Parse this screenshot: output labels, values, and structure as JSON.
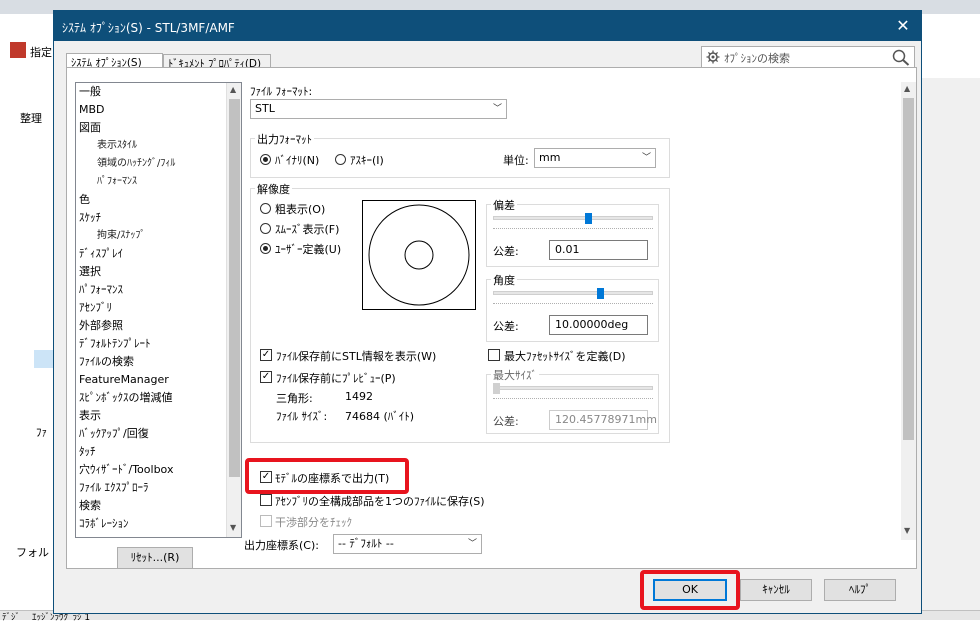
{
  "dialog": {
    "title": "ｼｽﾃﾑ ｵﾌﾟｼｮﾝ(S) - STL/3MF/AMF",
    "close": "✕",
    "tabs": [
      "ｼｽﾃﾑ ｵﾌﾟｼｮﾝ(S)",
      "ﾄﾞｷｭﾒﾝﾄ ﾌﾟﾛﾊﾟﾃｨ(D)"
    ],
    "search_placeholder": "ｵﾌﾟｼｮﾝの検索"
  },
  "tree": {
    "items": [
      {
        "label": "一般",
        "sub": false
      },
      {
        "label": "MBD",
        "sub": false
      },
      {
        "label": "図面",
        "sub": false
      },
      {
        "label": "表示ｽﾀｲﾙ",
        "sub": true
      },
      {
        "label": "領域のﾊｯﾁﾝｸﾞ/ﾌｨﾙ",
        "sub": true
      },
      {
        "label": "ﾊﾟﾌｫｰﾏﾝｽ",
        "sub": true
      },
      {
        "label": "色",
        "sub": false
      },
      {
        "label": "ｽｹｯﾁ",
        "sub": false
      },
      {
        "label": "拘束/ｽﾅｯﾌﾟ",
        "sub": true
      },
      {
        "label": "ﾃﾞｨｽﾌﾟﾚｲ",
        "sub": false
      },
      {
        "label": "選択",
        "sub": false
      },
      {
        "label": "ﾊﾟﾌｫｰﾏﾝｽ",
        "sub": false
      },
      {
        "label": "ｱｾﾝﾌﾞﾘ",
        "sub": false
      },
      {
        "label": "外部参照",
        "sub": false
      },
      {
        "label": "ﾃﾞﾌｫﾙﾄﾃﾝﾌﾟﾚｰﾄ",
        "sub": false
      },
      {
        "label": "ﾌｧｲﾙの検索",
        "sub": false
      },
      {
        "label": "FeatureManager",
        "sub": false
      },
      {
        "label": "ｽﾋﾟﾝﾎﾞｯｸｽの増減値",
        "sub": false
      },
      {
        "label": "表示",
        "sub": false
      },
      {
        "label": "ﾊﾞｯｸｱｯﾌﾟ/回復",
        "sub": false
      },
      {
        "label": "ﾀｯﾁ",
        "sub": false
      },
      {
        "label": "穴ｳｨｻﾞｰﾄﾞ/Toolbox",
        "sub": false
      },
      {
        "label": "ﾌｧｲﾙ ｴｸｽﾌﾟﾛｰﾗ",
        "sub": false
      },
      {
        "label": "検索",
        "sub": false
      },
      {
        "label": "ｺﾗﾎﾞﾚｰｼｮﾝ",
        "sub": false
      }
    ],
    "reset_button": "ﾘｾｯﾄ...(R)"
  },
  "file_format": {
    "label": "ﾌｧｲﾙ ﾌｫｰﾏｯﾄ:",
    "value": "STL"
  },
  "output_format": {
    "legend": "出力ﾌｫｰﾏｯﾄ",
    "binary": "ﾊﾞｲﾅﾘ(N)",
    "ascii": "ｱｽｷｰ(I)",
    "binary_selected": true,
    "unit_label": "単位:",
    "unit_value": "mm"
  },
  "resolution": {
    "legend": "解像度",
    "coarse": "粗表示(O)",
    "smooth": "ｽﾑｰｽﾞ表示(F)",
    "custom": "ﾕｰｻﾞｰ定義(U)",
    "selected": "custom",
    "deviation": {
      "legend": "偏差",
      "tol_label": "公差:",
      "tol_value": "0.01",
      "slider_fraction": 0.6
    },
    "angle": {
      "legend": "角度",
      "tol_label": "公差:",
      "tol_value": "10.00000deg",
      "slider_fraction": 0.68
    },
    "show_info": {
      "label": "ﾌｧｲﾙ保存前にSTL情報を表示(W)",
      "checked": true
    },
    "preview": {
      "label": "ﾌｧｲﾙ保存前にﾌﾟﾚﾋﾞｭｰ(P)",
      "checked": true
    },
    "triangles_label": "三角形:",
    "triangles_value": "1492",
    "filesize_label": "ﾌｧｲﾙ ｻｲｽﾞ:",
    "filesize_value": "74684 (ﾊﾞｲﾄ)",
    "max_facet": {
      "label": "最大ﾌｧｾｯﾄｻｲｽﾞを定義(D)",
      "checked": false
    },
    "max_size": {
      "legend": "最大ｻｲｽﾞ",
      "tol_label": "公差:",
      "tol_value": "120.45778971mm",
      "slider_fraction": 0.0
    }
  },
  "options": {
    "model_coords": {
      "label": "ﾓﾃﾞﾙの座標系で出力(T)",
      "checked": true
    },
    "assembly_single": {
      "label": "ｱｾﾝﾌﾞﾘの全構成部品を1つのﾌｧｲﾙに保存(S)",
      "checked": false
    },
    "interference": {
      "label": "干渉部分をﾁｪｯｸ",
      "checked": false
    }
  },
  "output_coord": {
    "label": "出力座標系(C):",
    "value": "-- ﾃﾞﾌｫﾙﾄ --"
  },
  "footer": {
    "ok": "OK",
    "cancel": "ｷｬﾝｾﾙ",
    "help": "ﾍﾙﾌﾟ"
  },
  "background": {
    "explorer_labels": [
      "指定",
      "整理",
      "ﾌｧ",
      "フォル"
    ],
    "bottom_labels": [
      "ﾃﾞｼﾞ",
      "ｴｯｼﾞﾝﾗｳｸﾞﾗｼ 1"
    ]
  },
  "colors": {
    "titlebar": "#0e4f7a",
    "accent": "#0078d7",
    "highlight": "#e8141e"
  }
}
